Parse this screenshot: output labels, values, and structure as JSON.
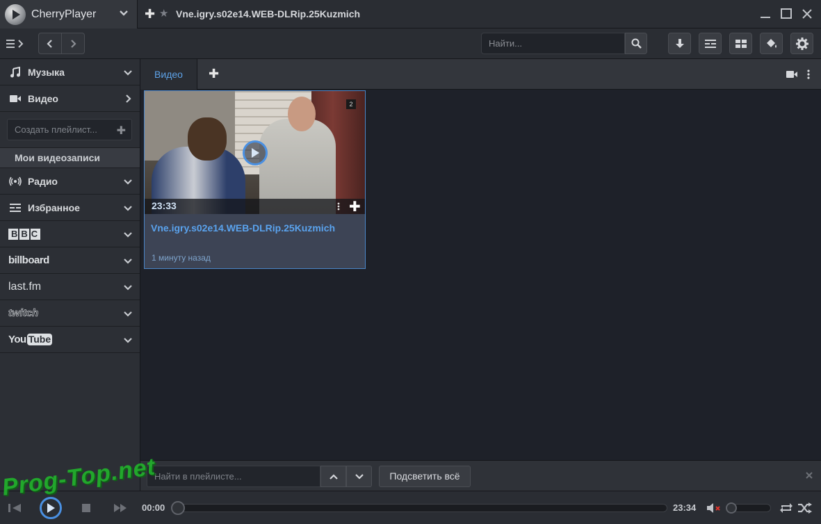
{
  "app": {
    "name": "CherryPlayer",
    "track_title": "Vne.igry.s02e14.WEB-DLRip.25Kuzmich"
  },
  "toolbar": {
    "search_placeholder": "Найти..."
  },
  "sidebar": {
    "music": "Музыка",
    "video": "Видео",
    "create_playlist_placeholder": "Создать плейлист...",
    "my_videos": "Мои видеозаписи",
    "radio": "Радио",
    "favorites": "Избранное",
    "bbc": "BBC",
    "billboard": "billboard",
    "lastfm": "last.fm",
    "twitch": "twitch",
    "youtube_you": "You",
    "youtube_tube": "Tube"
  },
  "tabs": {
    "active": "Видео"
  },
  "video_card": {
    "duration": "23:33",
    "title": "Vne.igry.s02e14.WEB-DLRip.25Kuzmich",
    "added": "1 минуту назад",
    "badge": "2"
  },
  "find_bar": {
    "placeholder": "Найти в плейлисте...",
    "highlight_label": "Подсветить всё"
  },
  "player": {
    "time_current": "00:00",
    "time_total": "23:34",
    "progress": 0,
    "volume": 0
  },
  "watermark": "Prog-Top.net",
  "colors": {
    "accent": "#4a90e2",
    "link": "#5aa3ee",
    "background": "#1e2129",
    "panel": "#2c2f35"
  }
}
